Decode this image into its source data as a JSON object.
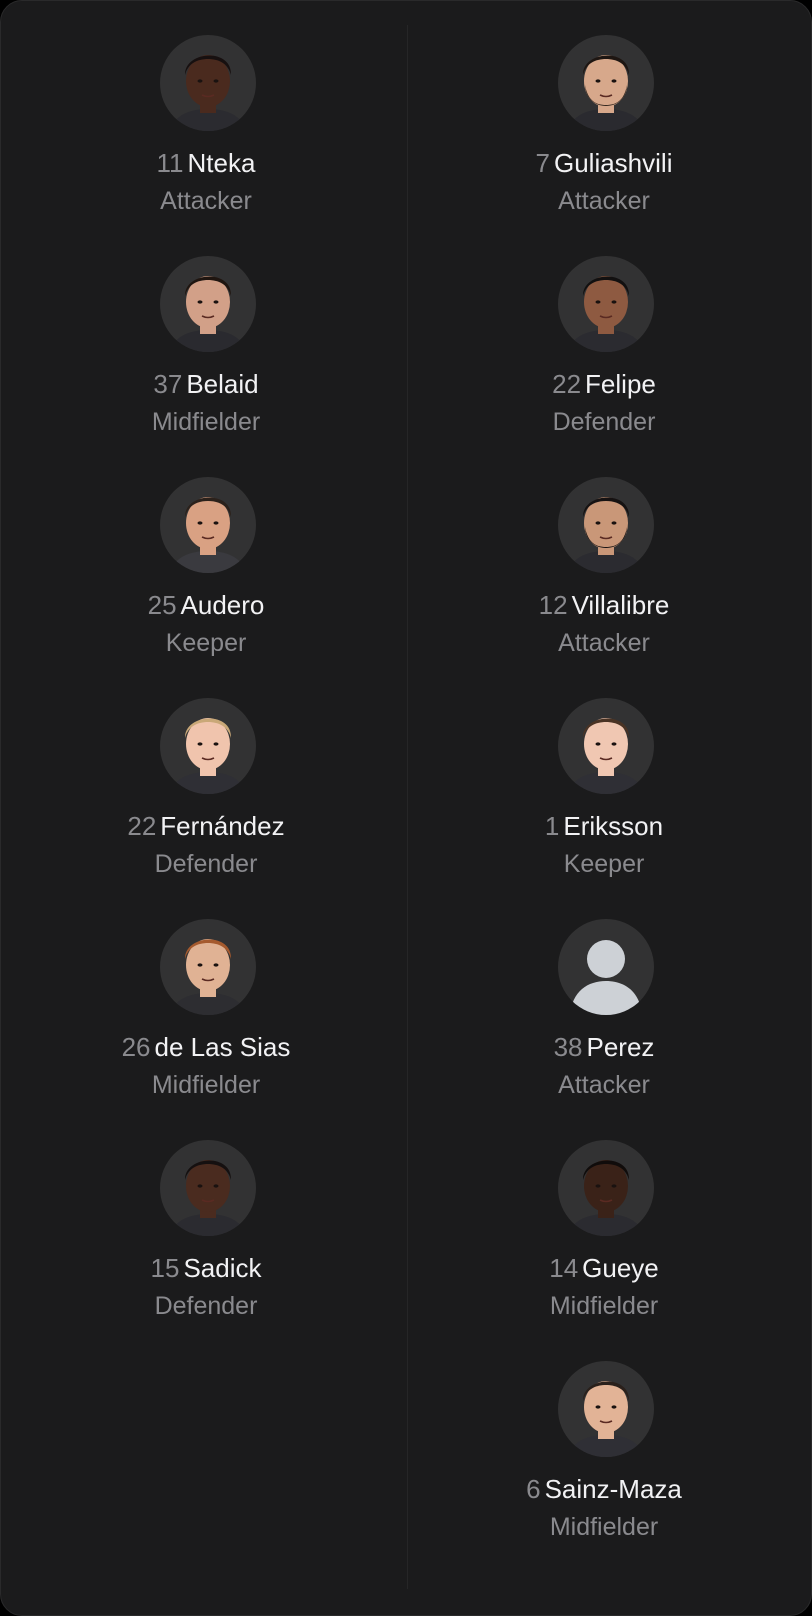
{
  "colors": {
    "background": "#1b1b1c",
    "avatar_bg": "#323233",
    "name": "#f2f2f4",
    "muted": "#8a8a8e",
    "placeholder": "#cdd1d6"
  },
  "players": {
    "left": [
      {
        "number": "11",
        "name": "Nteka",
        "position": "Attacker",
        "skin": "#4a2a1e",
        "hair": "#171010",
        "shirt": "#2b2b30"
      },
      {
        "number": "37",
        "name": "Belaid",
        "position": "Midfielder",
        "skin": "#d2a088",
        "hair": "#1f1510",
        "shirt": "#2a2a2f"
      },
      {
        "number": "25",
        "name": "Audero",
        "position": "Keeper",
        "skin": "#d9a183",
        "hair": "#2b211b",
        "shirt": "#3a3a3f"
      },
      {
        "number": "22",
        "name": "Fernández",
        "position": "Defender",
        "skin": "#f0c4ad",
        "hair": "#c9a878",
        "shirt": "#2f2f35"
      },
      {
        "number": "26",
        "name": "de Las Sias",
        "position": "Midfielder",
        "skin": "#e0b294",
        "hair": "#a55a2e",
        "shirt": "#2d2d31"
      },
      {
        "number": "15",
        "name": "Sadick",
        "position": "Defender",
        "skin": "#4a2b1f",
        "hair": "#151010",
        "shirt": "#2b2b30"
      }
    ],
    "right": [
      {
        "number": "7",
        "name": "Guliashvili",
        "position": "Attacker",
        "skin": "#d7a88b",
        "hair": "#1e1612",
        "shirt": "#2a2a2f",
        "beard": "#33261e"
      },
      {
        "number": "22",
        "name": "Felipe",
        "position": "Defender",
        "skin": "#8e5a41",
        "hair": "#121010",
        "shirt": "#2b2b30"
      },
      {
        "number": "12",
        "name": "Villalibre",
        "position": "Attacker",
        "skin": "#c99778",
        "hair": "#161212",
        "shirt": "#2b2b30",
        "beard": "#151111"
      },
      {
        "number": "1",
        "name": "Eriksson",
        "position": "Keeper",
        "skin": "#f0c7b2",
        "hair": "#4a3324",
        "shirt": "#2f2f35"
      },
      {
        "number": "38",
        "name": "Perez",
        "position": "Attacker",
        "placeholder": true
      },
      {
        "number": "14",
        "name": "Gueye",
        "position": "Midfielder",
        "skin": "#3a2218",
        "hair": "#100c0b",
        "shirt": "#2b2b30"
      },
      {
        "number": "6",
        "name": "Sainz-Maza",
        "position": "Midfielder",
        "skin": "#e2b396",
        "hair": "#2a201b",
        "shirt": "#2f2f35"
      }
    ]
  }
}
